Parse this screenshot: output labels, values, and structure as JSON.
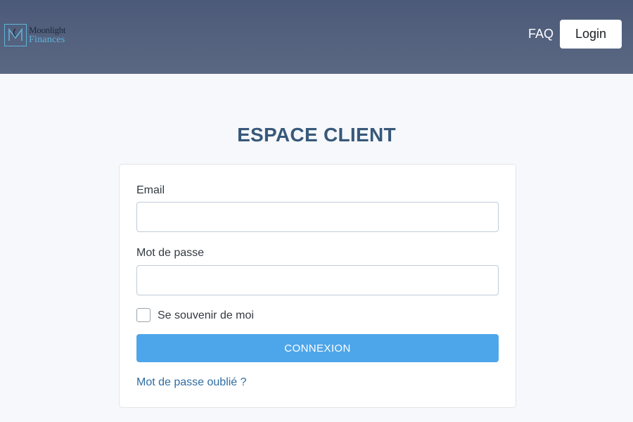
{
  "brand": {
    "name_line1": "Moonlight",
    "name_line2": "Finances",
    "logo_icon": "moonlight-monogram-icon"
  },
  "nav": {
    "faq_label": "FAQ",
    "login_label": "Login"
  },
  "colors": {
    "header": "#4c5a79",
    "title": "#38587a",
    "accent_button": "#4ea6ea",
    "link": "#2f6ca3",
    "logo_accent": "#5fb4d9"
  },
  "page": {
    "title": "ESPACE CLIENT"
  },
  "form": {
    "email_label": "Email",
    "email_value": "",
    "email_placeholder": "",
    "password_label": "Mot de passe",
    "password_value": "",
    "password_placeholder": "",
    "remember_label": "Se souvenir de moi",
    "remember_checked": false,
    "submit_label": "CONNEXION",
    "forgot_label": "Mot de passe oublié ?"
  }
}
